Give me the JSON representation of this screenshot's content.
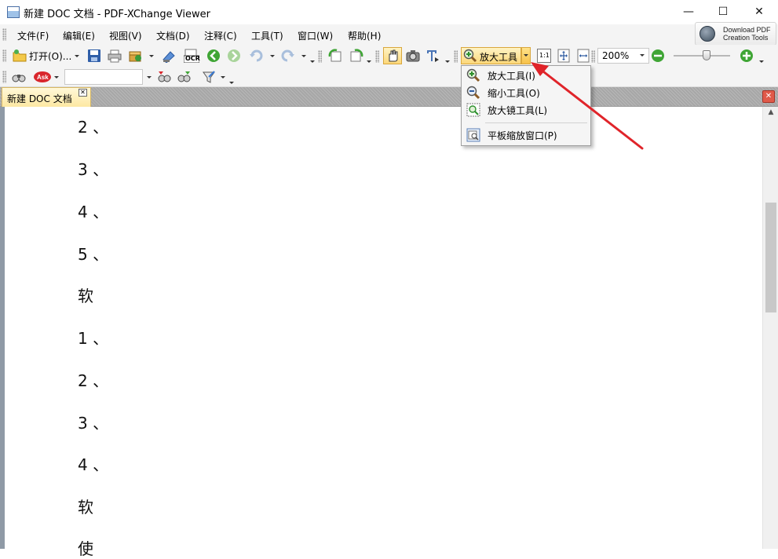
{
  "window": {
    "title": "新建 DOC 文档 - PDF-XChange Viewer",
    "minimize": "—",
    "maximize": "☐",
    "close": "✕"
  },
  "menu": [
    {
      "label": "文件(F)"
    },
    {
      "label": "编辑(E)"
    },
    {
      "label": "视图(V)"
    },
    {
      "label": "文档(D)"
    },
    {
      "label": "注释(C)"
    },
    {
      "label": "工具(T)"
    },
    {
      "label": "窗口(W)"
    },
    {
      "label": "帮助(H)"
    }
  ],
  "download": {
    "line1": "Download PDF",
    "line2": "Creation Tools"
  },
  "toolbar": {
    "open_label": "打开(O)...",
    "zoom_tool_label": "放大工具",
    "ocr_label": "OCR",
    "zoom_value": "200%",
    "fit_actual_label": "1:1"
  },
  "search": {
    "value": ""
  },
  "tab": {
    "title": "新建 DOC 文档",
    "close": "✕"
  },
  "close_all_tabs": "✕",
  "zoom_menu": {
    "items": [
      {
        "label": "放大工具(I)",
        "icon": "zoom-in-icon"
      },
      {
        "label": "缩小工具(O)",
        "icon": "zoom-out-icon"
      },
      {
        "label": "放大镜工具(L)",
        "icon": "loupe-icon"
      },
      {
        "label": "平板缩放窗口(P)",
        "icon": "pan-zoom-window-icon"
      }
    ]
  },
  "document": {
    "lines": [
      "2 、",
      "3 、",
      "4 、",
      "5 、",
      "软",
      "1 、",
      "2 、",
      "3 、",
      "4 、",
      "软",
      "使"
    ]
  },
  "colors": {
    "accent_arrow": "#e0242a",
    "tab_active": "#fde8a3",
    "zoom_button": "#fcd87a"
  }
}
